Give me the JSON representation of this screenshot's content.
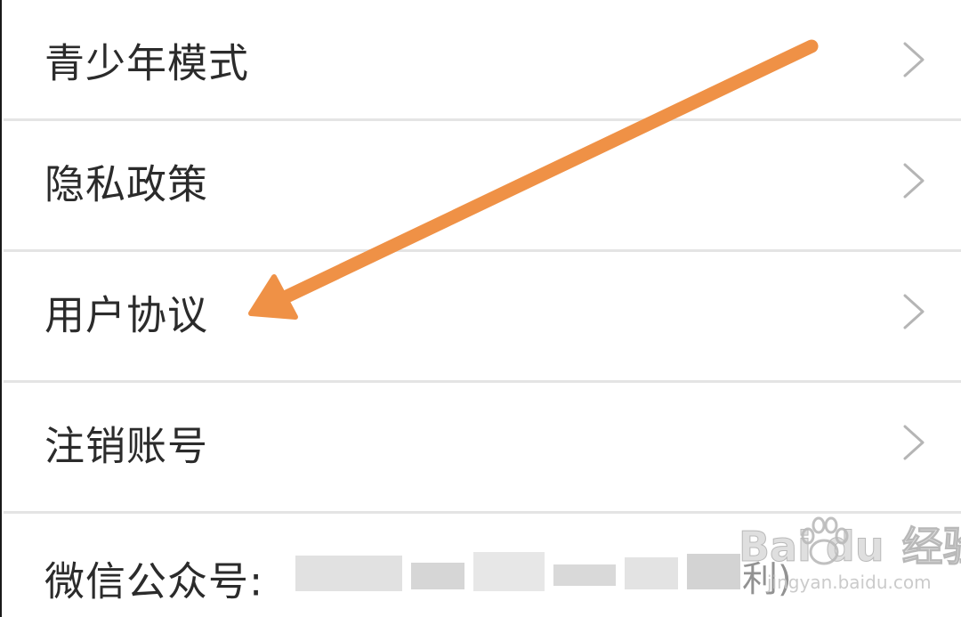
{
  "menu": {
    "items": [
      {
        "label": "青少年模式"
      },
      {
        "label": "隐私政策"
      },
      {
        "label": "用户协议"
      },
      {
        "label": "注销账号"
      }
    ],
    "wechat": {
      "label": "微信公众号:",
      "value_visible_fragment": "利)"
    }
  },
  "watermark": {
    "brand": "Bai  du",
    "suffix": "经验",
    "site": "jingyan.baidu.com"
  },
  "colors": {
    "arrow": "#ef9146",
    "label_text": "#2b2b2b",
    "divider": "#e4e4e4",
    "chevron": "#b5b5b5"
  },
  "icons": {
    "row_chevron": "chevron-right-icon",
    "annotation": "arrow-annotation"
  }
}
